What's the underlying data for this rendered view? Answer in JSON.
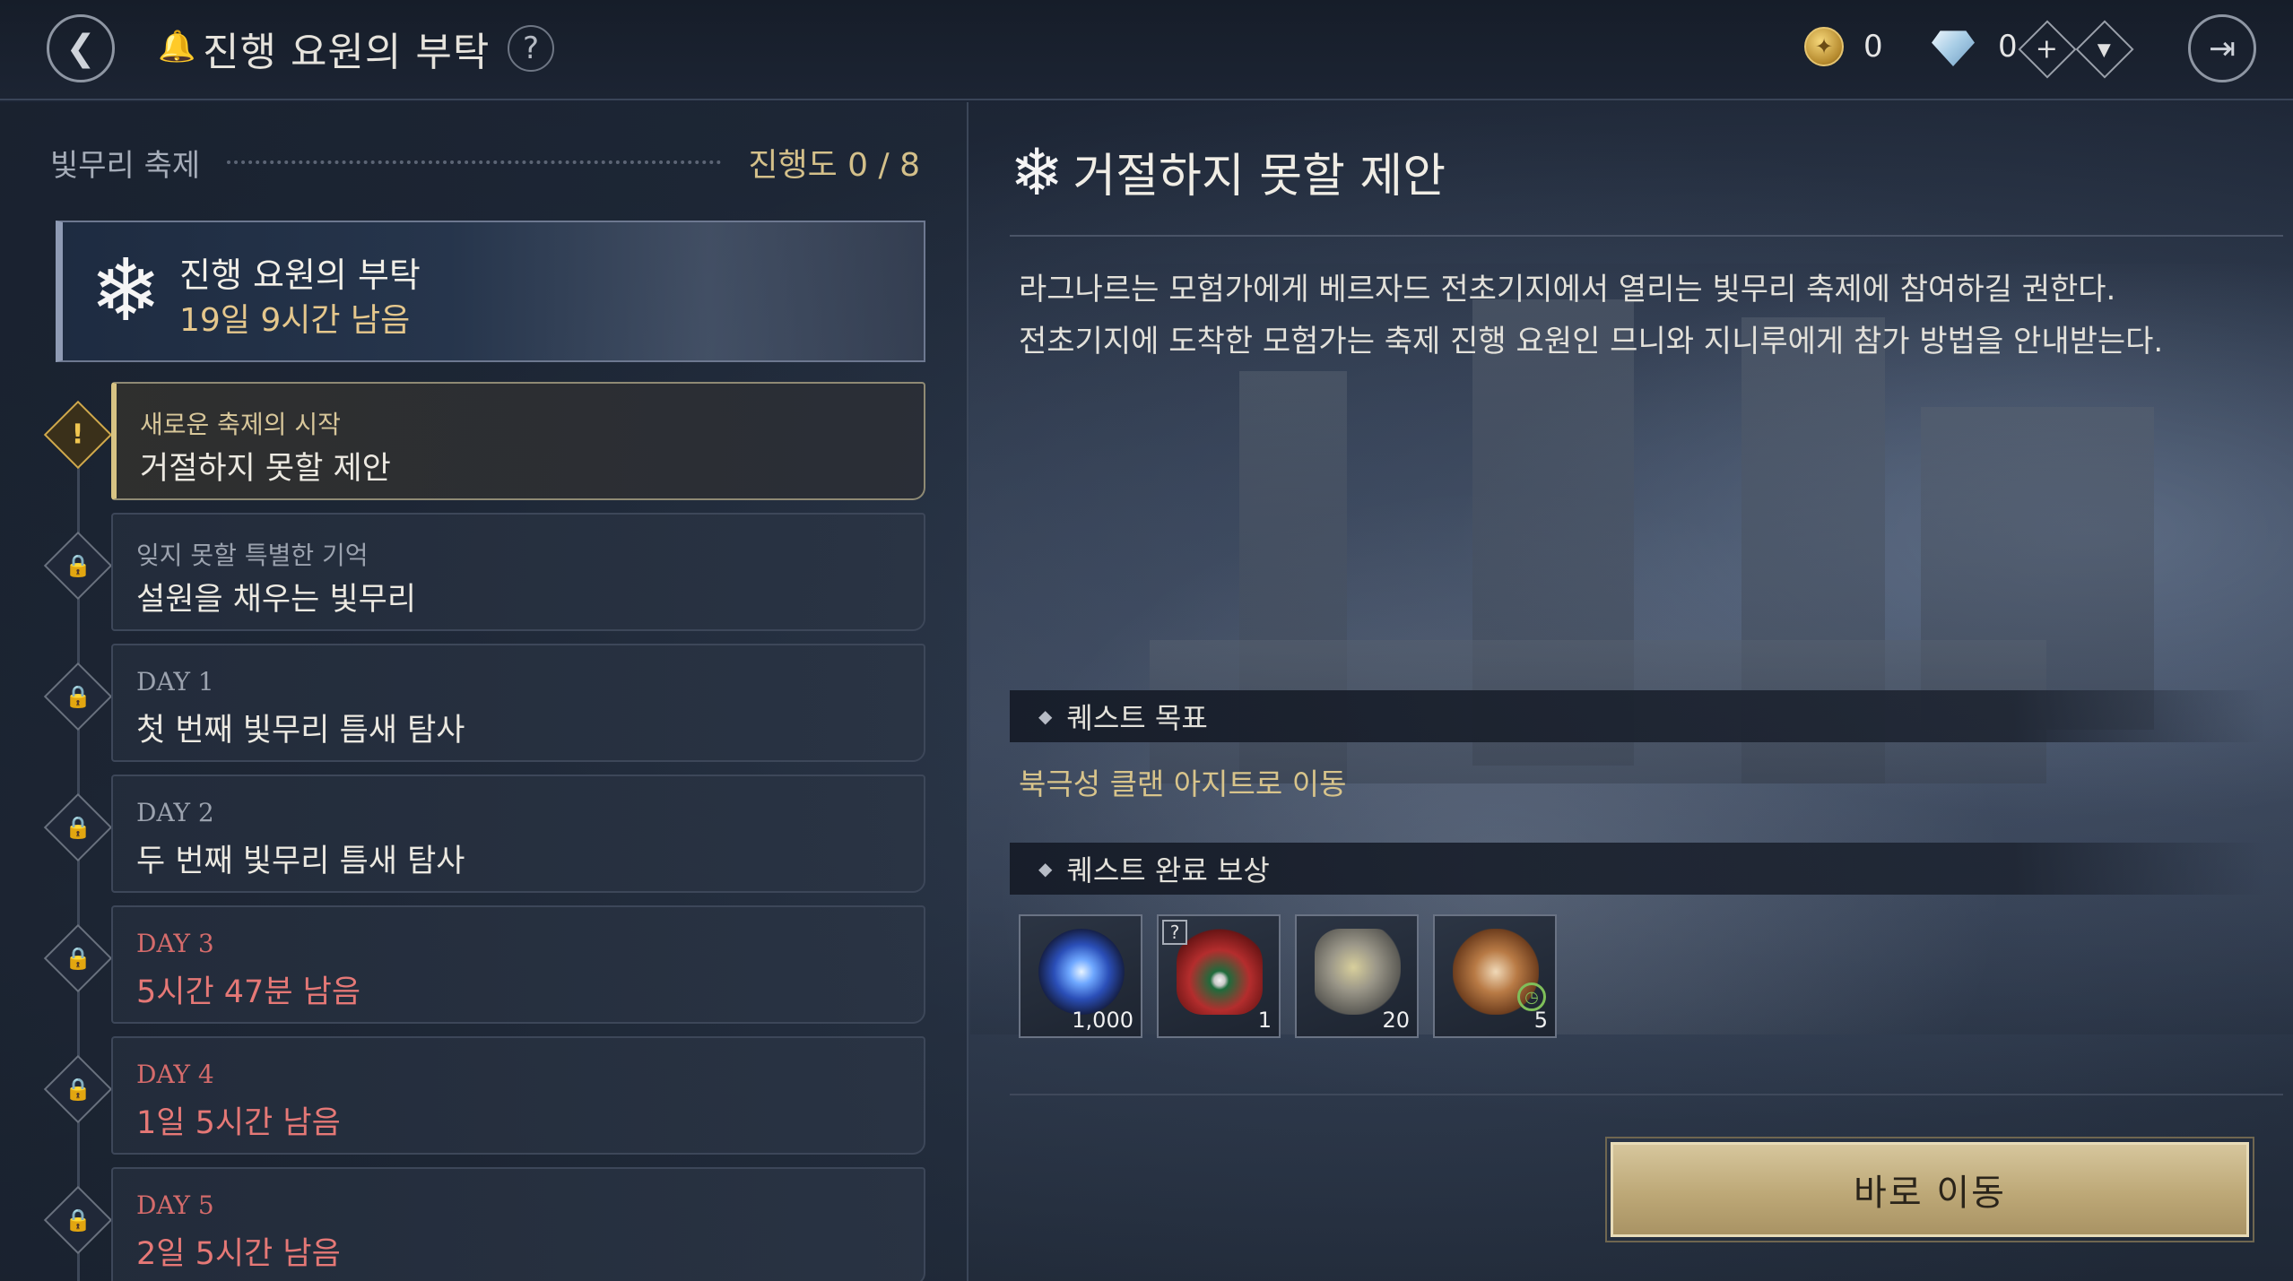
{
  "header": {
    "back_icon": "back-arrow-icon",
    "bell_icon": "bell-icon",
    "title": "진행 요원의 부탁",
    "help_label": "?",
    "gold": {
      "icon": "gold-coin-icon",
      "value": "0"
    },
    "crystal": {
      "icon": "crystal-icon",
      "value": "0"
    },
    "plus_label": "+",
    "dropdown_label": "▾",
    "exit_icon": "exit-icon"
  },
  "sidebar": {
    "section_label": "빛무리 축제",
    "progress": "진행도 0 / 8",
    "banner": {
      "icon": "snowflake-icon",
      "title": "진행 요원의 부탁",
      "remaining": "19일 9시간 남음"
    },
    "quests": [
      {
        "subtitle": "새로운 축제의 시작",
        "title": "거절하지 못할 제안",
        "state": "active",
        "node_icon": "alert-icon"
      },
      {
        "subtitle": "잊지 못할 특별한 기억",
        "title": "설원을 채우는 빛무리",
        "state": "locked",
        "node_icon": "lock-icon"
      },
      {
        "subtitle": "DAY 1",
        "title": "첫 번째 빛무리 틈새 탐사",
        "state": "locked",
        "node_icon": "lock-icon"
      },
      {
        "subtitle": "DAY 2",
        "title": "두 번째 빛무리 틈새 탐사",
        "state": "locked",
        "node_icon": "lock-icon"
      },
      {
        "subtitle": "DAY 3",
        "title": "5시간 47분 남음",
        "state": "timed",
        "node_icon": "lock-icon"
      },
      {
        "subtitle": "DAY 4",
        "title": "1일 5시간 남음",
        "state": "timed",
        "node_icon": "lock-icon"
      },
      {
        "subtitle": "DAY 5",
        "title": "2일 5시간 남음",
        "state": "timed",
        "node_icon": "lock-icon"
      }
    ]
  },
  "detail": {
    "icon": "snowflake-icon",
    "title": "거절하지 못할 제안",
    "description_line1": "라그나르는 모험가에게 베르자드 전초기지에서 열리는 빛무리 축제에 참여하길 권한다.",
    "description_line2": "전초기지에 도착한 모험가는 축제 진행 요원인 므니와 지니루에게 참가 방법을 안내받는다.",
    "objective_header": "퀘스트 목표",
    "objective": "북극성 클랜 아지트로 이동",
    "reward_header": "퀘스트 완료 보상",
    "rewards": [
      {
        "icon": "blue-orb-icon",
        "count": "1,000"
      },
      {
        "icon": "gift-bag-icon",
        "count": "1",
        "badge": "?"
      },
      {
        "icon": "stone-rune-icon",
        "count": "20"
      },
      {
        "icon": "bread-log-icon",
        "count": "5"
      }
    ],
    "go_button": "바로 이동"
  },
  "colors": {
    "accent_gold": "#d8c48b",
    "timed_red": "#e57876",
    "button_gold": "#bda877"
  }
}
